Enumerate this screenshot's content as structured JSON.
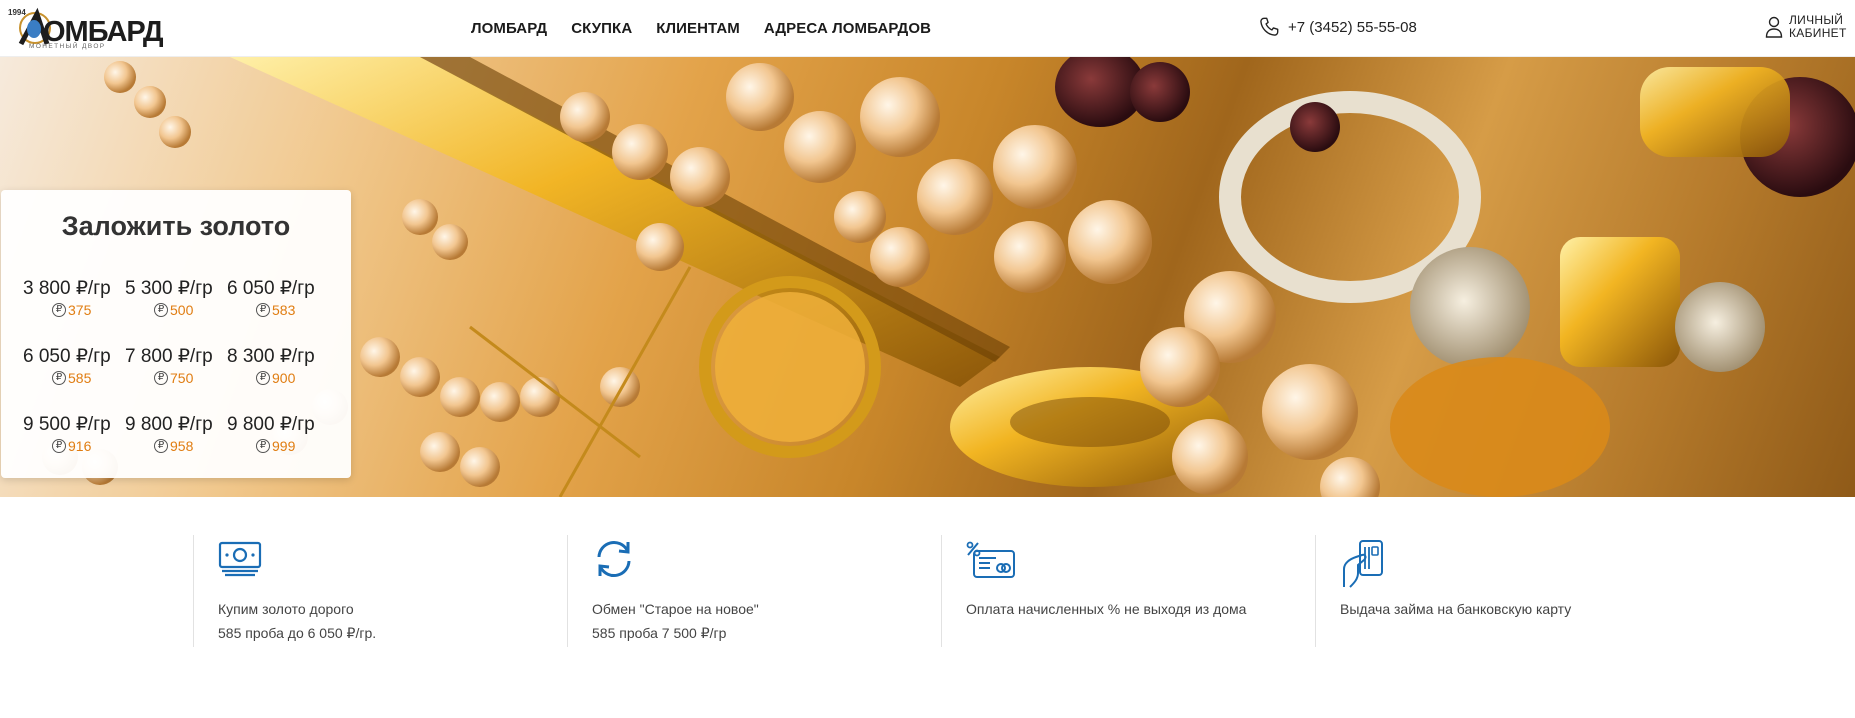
{
  "logo": {
    "year": "1994",
    "brand": "ОМБАРД",
    "subtitle": "МОНЕТНЫЙ ДВОР"
  },
  "nav": {
    "items": [
      {
        "label": "ЛОМБАРД"
      },
      {
        "label": "СКУПКА"
      },
      {
        "label": "КЛИЕНТАМ"
      },
      {
        "label": "АДРЕСА ЛОМБАРДОВ"
      }
    ]
  },
  "header": {
    "phone": "+7 (3452) 55-55-08",
    "cabinet_line1": "ЛИЧНЫЙ",
    "cabinet_line2": "КАБИНЕТ"
  },
  "price_card": {
    "title": "Заложить золото",
    "coin_glyph": "₽",
    "prices": [
      {
        "value": "3 800 ₽/гр",
        "probe": "375"
      },
      {
        "value": "5 300 ₽/гр",
        "probe": "500"
      },
      {
        "value": "6 050 ₽/гр",
        "probe": "583"
      },
      {
        "value": "6 050 ₽/гр",
        "probe": "585"
      },
      {
        "value": "7 800 ₽/гр",
        "probe": "750"
      },
      {
        "value": "8 300 ₽/гр",
        "probe": "900"
      },
      {
        "value": "9 500 ₽/гр",
        "probe": "916"
      },
      {
        "value": "9 800 ₽/гр",
        "probe": "958"
      },
      {
        "value": "9 800 ₽/гр",
        "probe": "999"
      }
    ]
  },
  "features": [
    {
      "icon": "cash-icon",
      "line1": "Купим золото дорого",
      "line2": "585 проба до 6 050 ₽/гр."
    },
    {
      "icon": "exchange-icon",
      "line1": "Обмен \"Старое на новое\"",
      "line2": "585 проба 7 500 ₽/гр"
    },
    {
      "icon": "card-percent-icon",
      "line1": "Оплата начисленных % не выходя из дома",
      "line2": ""
    },
    {
      "icon": "hand-card-icon",
      "line1": "Выдача займа на банковскую карту",
      "line2": ""
    }
  ],
  "colors": {
    "accent": "#e07d12",
    "icon_blue": "#1a6db5",
    "text": "#222222"
  }
}
